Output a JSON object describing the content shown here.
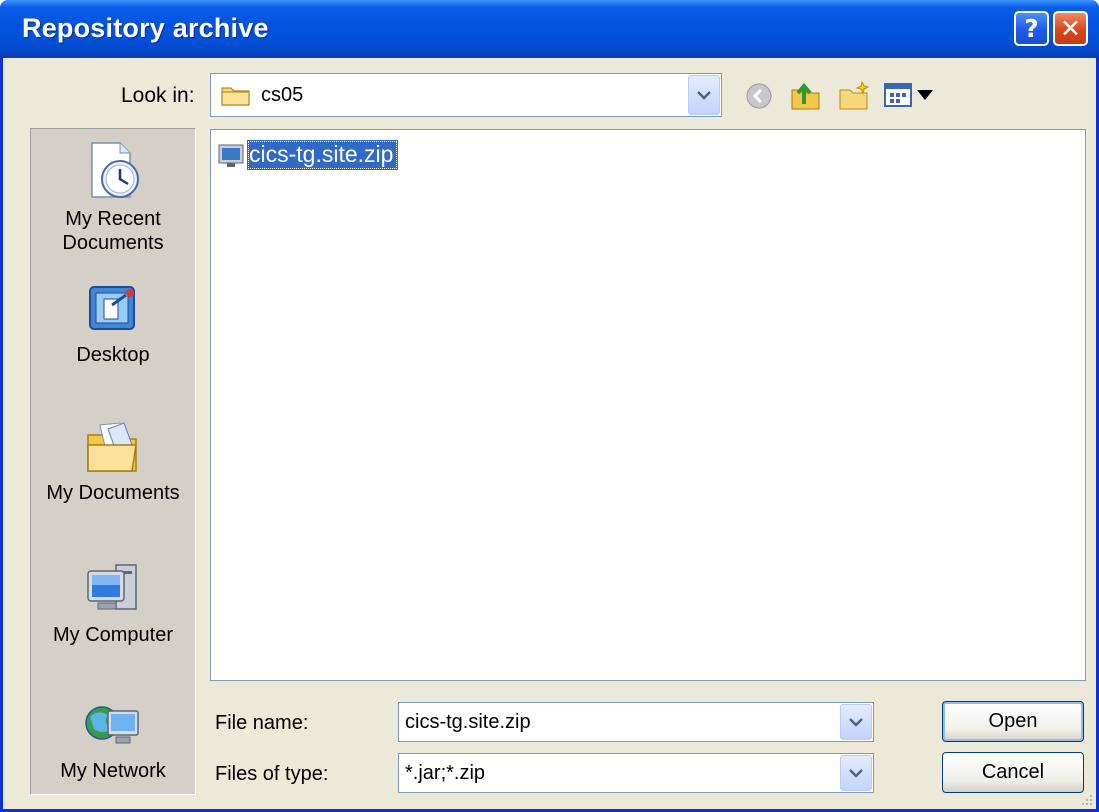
{
  "window": {
    "title": "Repository archive"
  },
  "title_buttons": {
    "help": "?",
    "close": "✕"
  },
  "look_in": {
    "label": "Look in:",
    "value": "cs05"
  },
  "toolbar": {
    "icons": [
      "back-icon",
      "up-folder-icon",
      "new-folder-icon",
      "views-menu-icon"
    ]
  },
  "places": [
    {
      "label": "My Recent Documents",
      "icon": "recent-documents-icon"
    },
    {
      "label": "Desktop",
      "icon": "desktop-icon"
    },
    {
      "label": "My Documents",
      "icon": "my-documents-icon"
    },
    {
      "label": "My Computer",
      "icon": "my-computer-icon"
    },
    {
      "label": "My Network",
      "icon": "my-network-icon"
    }
  ],
  "files": [
    {
      "name": "cics-tg.site.zip",
      "selected": true
    }
  ],
  "file_name": {
    "label": "File name:",
    "value": "cics-tg.site.zip"
  },
  "file_type": {
    "label": "Files of type:",
    "value": "*.jar;*.zip"
  },
  "buttons": {
    "open": "Open",
    "cancel": "Cancel"
  },
  "colors": {
    "title_bar": "#0453e0",
    "selection": "#316ac5",
    "dialog_bg": "#ece9d8",
    "places_bg": "#d4d0c8"
  }
}
